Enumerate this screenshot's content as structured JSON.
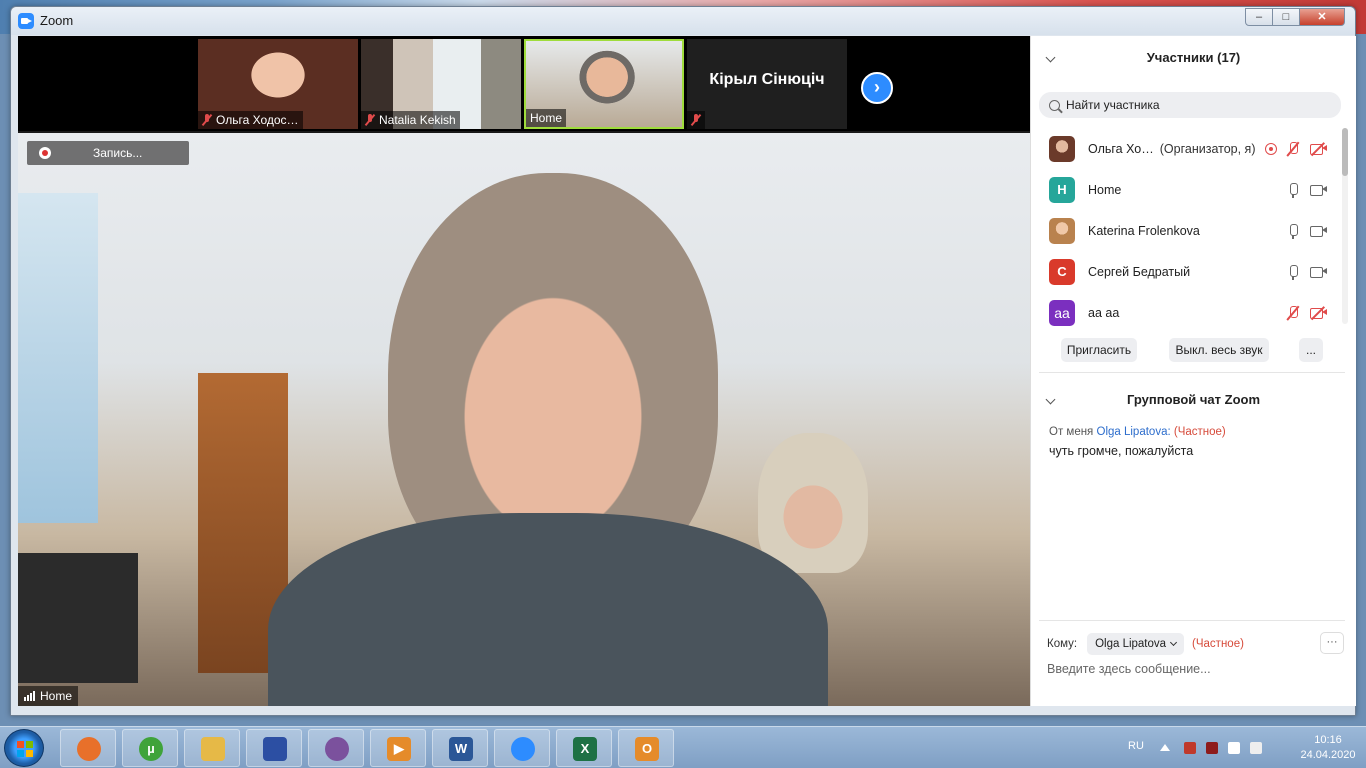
{
  "window": {
    "title": "Zoom",
    "min": "–",
    "max": "□",
    "close": "✕"
  },
  "strip": {
    "thumbs": [
      {
        "label": "Ольга Ходос…",
        "muted": true
      },
      {
        "label": "Natalia Kekish",
        "muted": true
      },
      {
        "label": "Home",
        "muted": false
      },
      {
        "label": "Кірыл Сінюціч",
        "muted": true
      }
    ],
    "next": "›"
  },
  "main": {
    "recording": "Запись...",
    "speaker": "Home"
  },
  "participants": {
    "title": "Участники (17)",
    "search_placeholder": "Найти участника",
    "items": [
      {
        "initial": "",
        "name": "Ольга Хо…",
        "role": "(Организатор, я)",
        "color": "",
        "mic": "off",
        "cam": "off",
        "rec": true
      },
      {
        "initial": "H",
        "name": "Home",
        "role": "",
        "color": "#26a69a",
        "mic": "on",
        "cam": "on",
        "rec": false
      },
      {
        "initial": "",
        "name": "Katerina Frolenkova",
        "role": "",
        "color": "",
        "mic": "on",
        "cam": "on",
        "rec": false
      },
      {
        "initial": "С",
        "name": "Сергей Бедратый",
        "role": "",
        "color": "#d93a2b",
        "mic": "on",
        "cam": "on",
        "rec": false
      },
      {
        "initial": "aa",
        "name": "аа аа",
        "role": "",
        "color": "#7b2fbf",
        "mic": "off",
        "cam": "off",
        "rec": false
      }
    ],
    "invite": "Пригласить",
    "mute_all": "Выкл. весь звук",
    "more": "..."
  },
  "chat": {
    "title": "Групповой чат Zoom",
    "message": {
      "from": "От меня",
      "to": "Olga Lipatova:",
      "private": "(Частное)",
      "text": "чуть громче, пожалуйста"
    },
    "to_label": "Кому:",
    "to_value": "Olga Lipatova",
    "to_private": "(Частное)",
    "more": "···",
    "input_placeholder": "Введите здесь сообщение..."
  },
  "taskbar": {
    "apps": [
      {
        "name": "firefox-icon",
        "color": "#e8702a",
        "glyph": ""
      },
      {
        "name": "utorrent-icon",
        "color": "#3fa33a",
        "glyph": "µ"
      },
      {
        "name": "explorer-icon",
        "color": "#e6b947",
        "glyph": ""
      },
      {
        "name": "save-icon",
        "color": "#2c4fa3",
        "glyph": ""
      },
      {
        "name": "viber-icon",
        "color": "#7b519d",
        "glyph": ""
      },
      {
        "name": "media-player-icon",
        "color": "#e58b2a",
        "glyph": "▶"
      },
      {
        "name": "word-icon",
        "color": "#2b5797",
        "glyph": "W"
      },
      {
        "name": "zoom-icon",
        "color": "#2d8cff",
        "glyph": ""
      },
      {
        "name": "excel-icon",
        "color": "#1e7145",
        "glyph": "X"
      },
      {
        "name": "outlook-icon",
        "color": "#e58b2a",
        "glyph": "O"
      }
    ],
    "lang": "RU",
    "time": "10:16",
    "date": "24.04.2020"
  }
}
